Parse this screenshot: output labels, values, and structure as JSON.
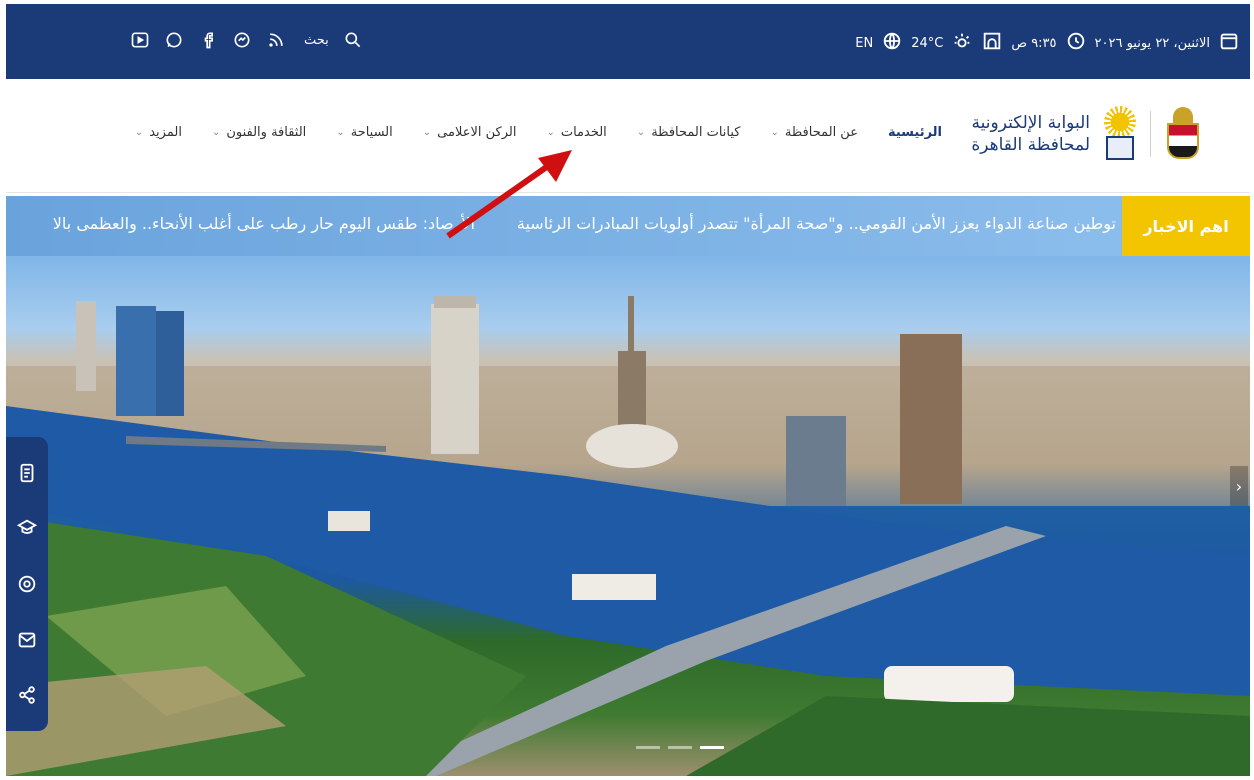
{
  "topbar": {
    "search_label": "بحث",
    "date": "الاثنين، ٢٢ يونيو ٢٠٢٦",
    "time": "٩:٣٥ ص",
    "temperature": "24°C",
    "lang": "EN",
    "social_icons": [
      "youtube-icon",
      "whatsapp-icon",
      "facebook-icon",
      "messenger-icon",
      "rss-icon"
    ]
  },
  "logo": {
    "line1": "البوابة الإلكترونية",
    "line2": "لمحافظة القاهرة"
  },
  "menu": {
    "items": [
      {
        "label": "الرئيسية"
      },
      {
        "label": "عن المحافظة"
      },
      {
        "label": "كيانات المحافظة"
      },
      {
        "label": "الخدمات"
      },
      {
        "label": "الركن الاعلامى"
      },
      {
        "label": "السياحة"
      },
      {
        "label": "الثقافة والفنون"
      },
      {
        "label": "المزيد"
      }
    ]
  },
  "ticker": {
    "badge": "اهم الاخبار",
    "items": [
      "توطين صناعة الدواء يعزز الأمن القومي.. و\"صحة المرأة\" تتصدر أولويات المبادرات الرئاسية",
      "الأرصاد: طقس اليوم حار رطب على أغلب الأنحاء.. والعظمى بالا"
    ]
  },
  "colors": {
    "brand_blue": "#1b3a78",
    "accent_yellow": "#f3c400",
    "annotation_red": "#d01010"
  }
}
